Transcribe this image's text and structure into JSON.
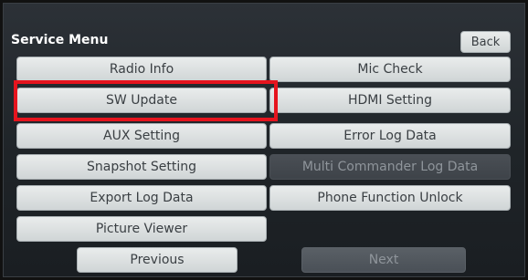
{
  "header": {
    "title": "Service Menu",
    "back_label": "Back"
  },
  "menu": {
    "radio_info": "Radio Info",
    "mic_check": "Mic Check",
    "sw_update": "SW Update",
    "hdmi_setting": "HDMI Setting",
    "aux_setting": "AUX Setting",
    "error_log_data": "Error Log Data",
    "snapshot_setting": "Snapshot Setting",
    "multi_commander_log_data": "Multi Commander Log Data",
    "export_log_data": "Export Log Data",
    "phone_function_unlock": "Phone Function Unlock",
    "picture_viewer": "Picture Viewer"
  },
  "pager": {
    "previous_label": "Previous",
    "next_label": "Next"
  },
  "colors": {
    "highlight": "#e6141e",
    "button_face": "#dfe3e4",
    "screen_bg": "#23282d"
  }
}
